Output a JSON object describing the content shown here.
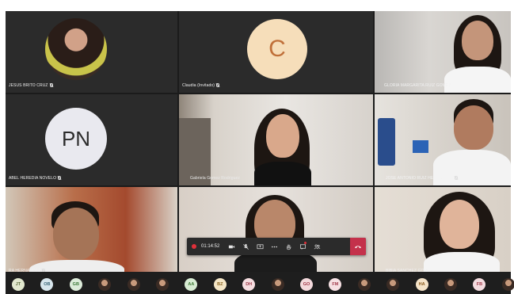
{
  "participants": [
    {
      "name": "JESUS BRITO CRUZ"
    },
    {
      "name": "Claudia (Invitado)",
      "initial": "C"
    },
    {
      "name": "GLORIA MARGARITA RUIZ GOMEZ"
    },
    {
      "name": "ABEL HEREDIA NOVELO",
      "initials": "PN"
    },
    {
      "name": "Gabriela Gomez Rodriguez"
    },
    {
      "name": "JOSE ANTONIO RUIZ HERNANDEZ"
    },
    {
      "name": "RA HERNANDEZ"
    },
    {
      "name": ""
    },
    {
      "name": "BIBIA SANCHEZ GOMEZ"
    }
  ],
  "toolbar": {
    "timer": "01:14:52",
    "buttons": [
      "camera-icon",
      "microphone-icon",
      "share-screen-icon",
      "more-icon",
      "raise-hand-icon",
      "chat-icon",
      "participants-icon",
      "hang-up-icon"
    ]
  },
  "strip": {
    "avatars": [
      {
        "initials": "JT",
        "color": "#e2e8cf",
        "fg": "#5b6b3a"
      },
      {
        "initials": "OB",
        "color": "#d8e6ec",
        "fg": "#3d6778"
      },
      {
        "initials": "GB",
        "color": "#dcebd9",
        "fg": "#3d7a3a"
      },
      {
        "initials": "",
        "photo": true
      },
      {
        "initials": "",
        "photo": true
      },
      {
        "initials": "",
        "photo": true
      },
      {
        "initials": "AA",
        "color": "#d7ecd3",
        "fg": "#3f7a36"
      },
      {
        "initials": "BZ",
        "color": "#f5e6c6",
        "fg": "#8a6420"
      },
      {
        "initials": "DH",
        "color": "#f5dde0",
        "fg": "#9c3b4a"
      },
      {
        "initials": "",
        "photo": true
      },
      {
        "initials": "GO",
        "color": "#f3d9dc",
        "fg": "#a03848"
      },
      {
        "initials": "FM",
        "color": "#f6e0e3",
        "fg": "#a33b4c"
      },
      {
        "initials": "",
        "photo": true
      },
      {
        "initials": "",
        "photo": true
      },
      {
        "initials": "HA",
        "color": "#f5e3c8",
        "fg": "#8a5a1d"
      },
      {
        "initials": "",
        "photo": true
      },
      {
        "initials": "FB",
        "color": "#f4dce0",
        "fg": "#a03a4a"
      },
      {
        "initials": "",
        "photo": true
      }
    ]
  },
  "colors": {
    "hangup": "#c4314b",
    "recording": "#e0303a",
    "avatar_circle": "#f6deba",
    "avatar_text": "#c0703a",
    "pn_circle": "#e9e9ef",
    "pn_text": "#2b2b2b"
  }
}
